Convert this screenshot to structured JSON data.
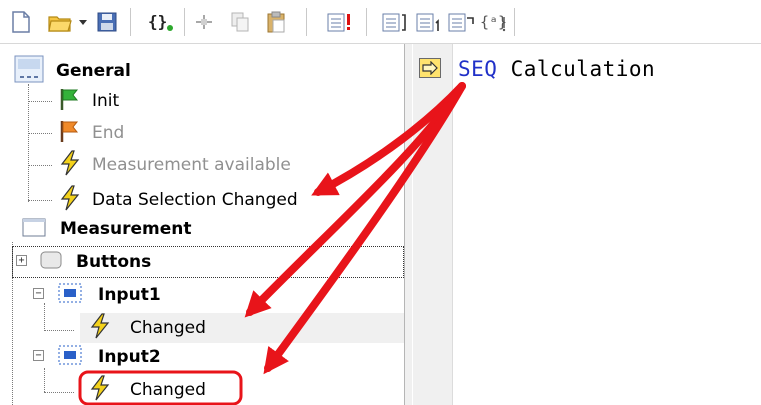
{
  "toolbar": {
    "buttons": [
      {
        "name": "new-document-icon"
      },
      {
        "name": "open-folder-icon"
      },
      {
        "name": "dropdown-arrow-icon"
      },
      {
        "name": "save-disk-icon"
      },
      {
        "name": "braces-icon"
      },
      {
        "name": "connect-icon"
      },
      {
        "name": "copy-icon"
      },
      {
        "name": "paste-icon"
      },
      {
        "name": "list-alert-icon"
      },
      {
        "name": "list-bracket-icon"
      },
      {
        "name": "list-index-icon"
      },
      {
        "name": "list-arrow-icon"
      },
      {
        "name": "brace-variable-icon"
      }
    ]
  },
  "tree": {
    "general": {
      "label": "General"
    },
    "init": {
      "label": "Init"
    },
    "end": {
      "label": "End"
    },
    "measurement_available": {
      "label": "Measurement available"
    },
    "data_selection_changed": {
      "label": "Data Selection Changed"
    },
    "measurement": {
      "label": "Measurement"
    },
    "buttons": {
      "label": "Buttons",
      "expander": "+"
    },
    "input1": {
      "label": "Input1",
      "expander": "−"
    },
    "input1_changed": {
      "label": "Changed"
    },
    "input2": {
      "label": "Input2",
      "expander": "−"
    },
    "input2_changed": {
      "label": "Changed"
    }
  },
  "editor": {
    "keyword": "SEQ",
    "rest": " Calculation"
  },
  "colors": {
    "arrow": "#e8141a",
    "highlight": "#e8141a",
    "keyword": "#2030c8",
    "marker": "#ffe36e"
  }
}
